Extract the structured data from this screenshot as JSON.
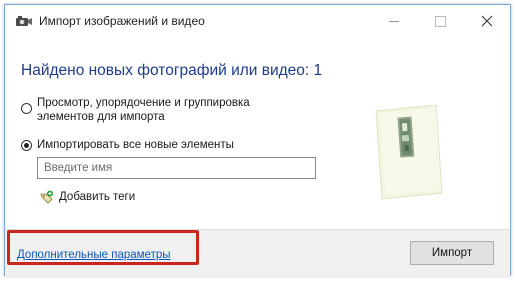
{
  "window": {
    "title": "Импорт изображений и видео",
    "title_icon": "camera-import-icon",
    "controls": [
      "minimize-icon",
      "maximize-icon",
      "close-icon"
    ]
  },
  "main": {
    "headline": "Найдено новых фотографий или видео: 1",
    "options": [
      {
        "label": "Просмотр, упорядочение и группировка элементов для импорта",
        "selected": false
      },
      {
        "label": "Импортировать все новые элементы",
        "selected": true
      }
    ],
    "name_input": {
      "value": "",
      "placeholder": "Введите имя"
    },
    "add_tags_label": "Добавить теги",
    "add_tags_icon": "tag-add-icon",
    "preview_icon": "photo-thumbnail-icon"
  },
  "footer": {
    "more_options_link": "Дополнительные параметры",
    "import_button": "Импорт"
  },
  "colors": {
    "headline": "#1e3c8c",
    "link": "#0a57c2",
    "highlight_border": "#c8261f",
    "footer_bg": "#f0f0f0"
  }
}
